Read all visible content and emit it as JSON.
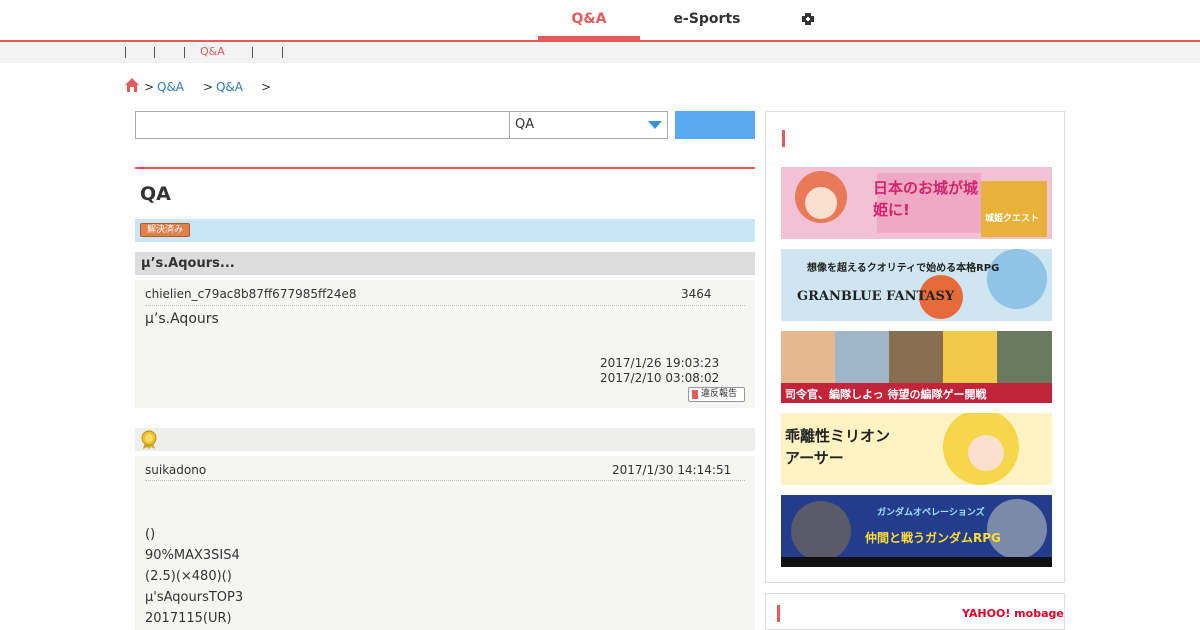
{
  "nav": {
    "tabs": [
      {
        "label": "Q&A"
      },
      {
        "label": "e-Sports"
      }
    ],
    "icon": "gamepad-icon"
  },
  "subnav": {
    "active": "Q&A"
  },
  "breadcrumb": {
    "sep": ">",
    "items": [
      "Q&A",
      "Q&A"
    ]
  },
  "search": {
    "select_value": "QA"
  },
  "page": {
    "title": "QA",
    "badge": "解決済み"
  },
  "question": {
    "title": "μ’s.Aqours...",
    "user": "chielien_c79ac8b87ff677985ff24e8",
    "views": "3464",
    "text": "μ’s.Aqours",
    "date_posted": "2017/1/26 19:03:23",
    "date_updated": "2017/2/10 03:08:02",
    "report_label": "違反報告"
  },
  "answer": {
    "user": "suikadono",
    "date": "2017/1/30 14:14:51",
    "lines": [
      "()",
      "90%MAX3SIS4",
      "(2.5)(×480)()",
      "μ'sAqoursTOP3",
      "2017115(UR)"
    ]
  },
  "sidebar": {
    "banners": [
      {
        "text": "日本のお城が城姫に!",
        "sub": "城姫クエスト",
        "bg": "#f3c1d4"
      },
      {
        "text": "想像を超えるクオリティで始める本格RPG",
        "sub": "GRANBLUE FANTASY",
        "bg": "#cfe6f2"
      },
      {
        "text": "司令官、編隊しよっ 待望の編隊ゲー開戦",
        "sub": "",
        "bg": "#c2243a"
      },
      {
        "text": "乖離性ミリオンアーサー",
        "sub": "",
        "bg": "#fff3c4"
      },
      {
        "text": "仲間と戦うガンダムRPG",
        "sub": "ガンダムオペレーションズ",
        "bg": "#233d8c"
      }
    ],
    "yahoo_label": "YAHOO! mobage"
  },
  "colors": {
    "accent": "#e45b5b",
    "link": "#2a7ab0",
    "button": "#5aa8f0"
  }
}
